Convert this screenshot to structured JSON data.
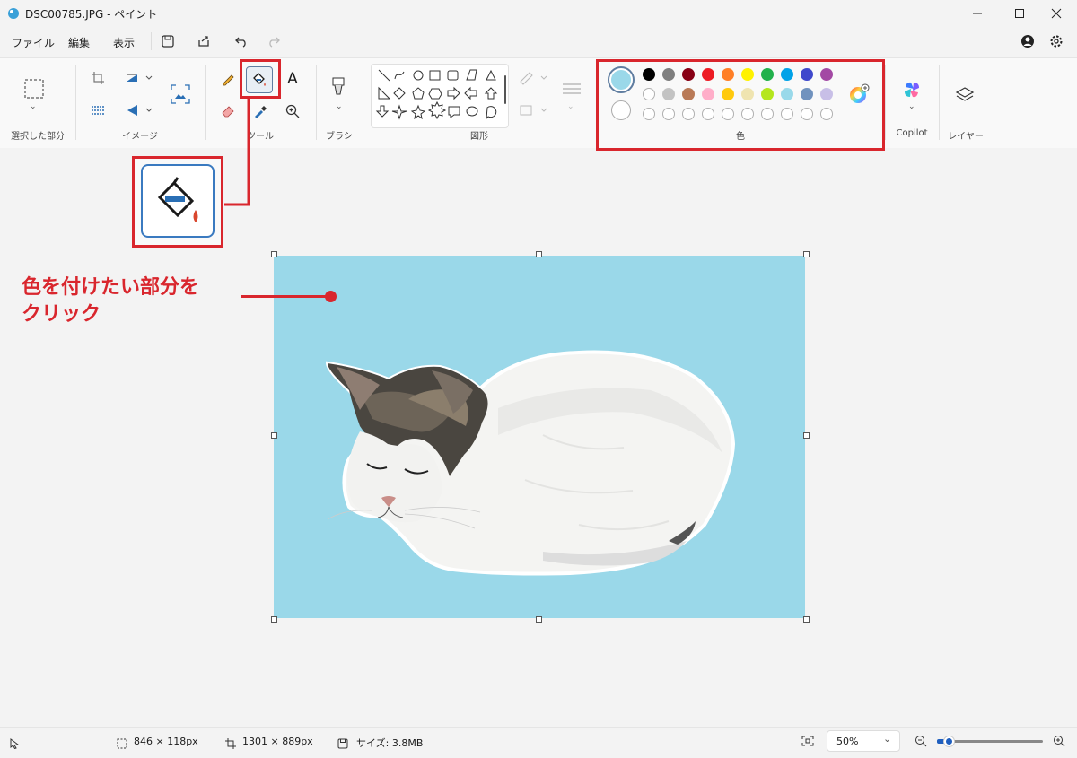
{
  "window": {
    "title": "DSC00785.JPG - ペイント"
  },
  "menu": {
    "file": "ファイル",
    "edit": "編集",
    "view": "表示"
  },
  "ribbon": {
    "groups": {
      "selection": "選択した部分",
      "image": "イメージ",
      "tools": "ツール",
      "brushes": "ブラシ",
      "shapes": "図形",
      "colors": "色",
      "copilot": "Copilot",
      "layers": "レイヤー"
    },
    "text_tool": "A",
    "primary_color": "#9ad8e9",
    "secondary_color": "#ffffff",
    "palette_row1": [
      "#000000",
      "#7f7f7f",
      "#880015",
      "#ed1c24",
      "#ff7f27",
      "#fff200",
      "#22b14c",
      "#00a2e8",
      "#3f48cc",
      "#a349a4"
    ],
    "palette_row2": [
      "#ffffff",
      "#c3c3c3",
      "#b97a57",
      "#ffaec9",
      "#ffc90e",
      "#efe4b0",
      "#b5e61d",
      "#99d9ea",
      "#7092be",
      "#c8bfe7"
    ]
  },
  "annotation": {
    "line1": "色を付けたい部分を",
    "line2": "クリック",
    "accent_color": "#d9262d"
  },
  "status": {
    "selection_size": "846 × 118px",
    "image_size": "1301 × 889px",
    "file_size": "サイズ: 3.8MB",
    "zoom": "50%"
  }
}
